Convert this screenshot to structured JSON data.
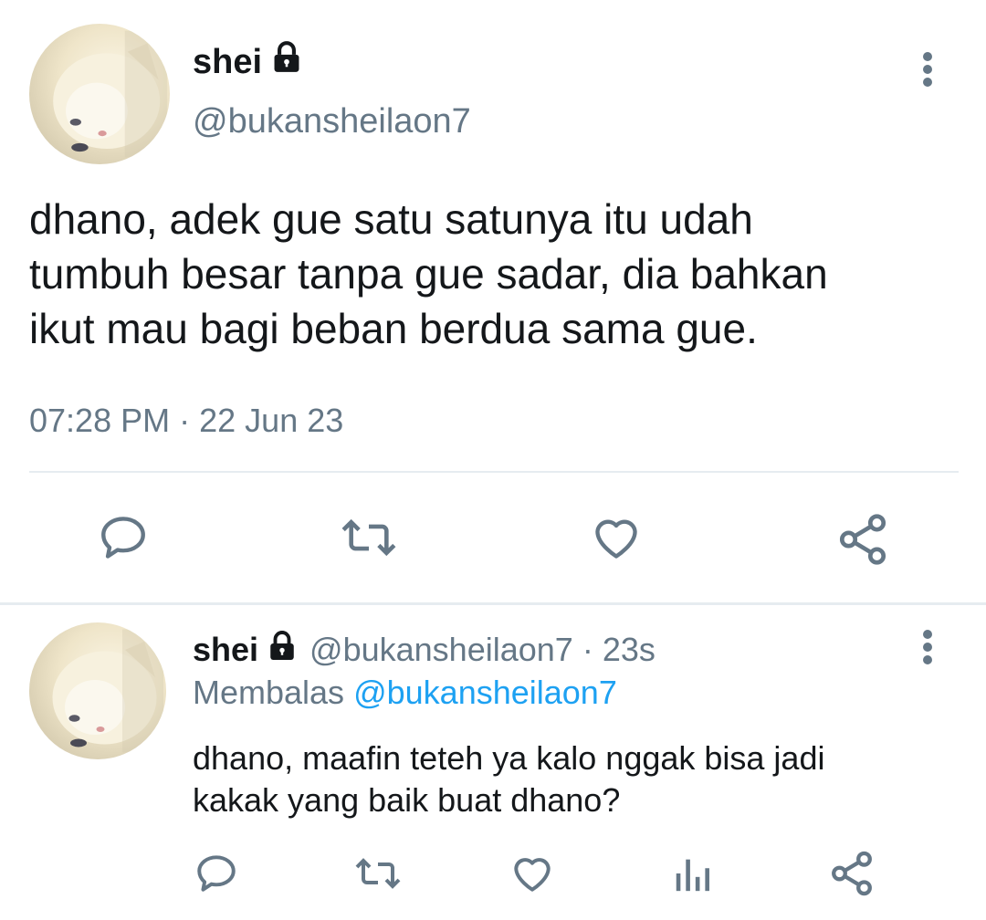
{
  "main_tweet": {
    "display_name": "shei",
    "handle": "@bukansheilaon7",
    "text_lines": [
      "dhano, adek gue satu satunya itu udah",
      "tumbuh besar tanpa gue sadar, dia bahkan",
      "ikut mau bagi beban berdua sama gue."
    ],
    "time": "07:28 PM",
    "separator": "·",
    "date": "22 Jun 23"
  },
  "reply_tweet": {
    "display_name": "shei",
    "handle": "@bukansheilaon7",
    "separator": "·",
    "age": "23s",
    "replying_label": "Membalas",
    "replying_to": "@bukansheilaon7",
    "text_lines": [
      "dhano, maafin teteh ya kalo nggak bisa jadi",
      "kakak yang baik buat dhano?"
    ]
  },
  "icons": {
    "reply": "reply-icon",
    "retweet": "retweet-icon",
    "like": "heart-icon",
    "share": "share-icon",
    "analytics": "analytics-icon",
    "lock": "lock-icon",
    "more": "more-vertical-icon"
  },
  "colors": {
    "text": "#14171a",
    "secondary": "#657786",
    "accent": "#1da1f2",
    "divider": "#e6ecf0"
  }
}
